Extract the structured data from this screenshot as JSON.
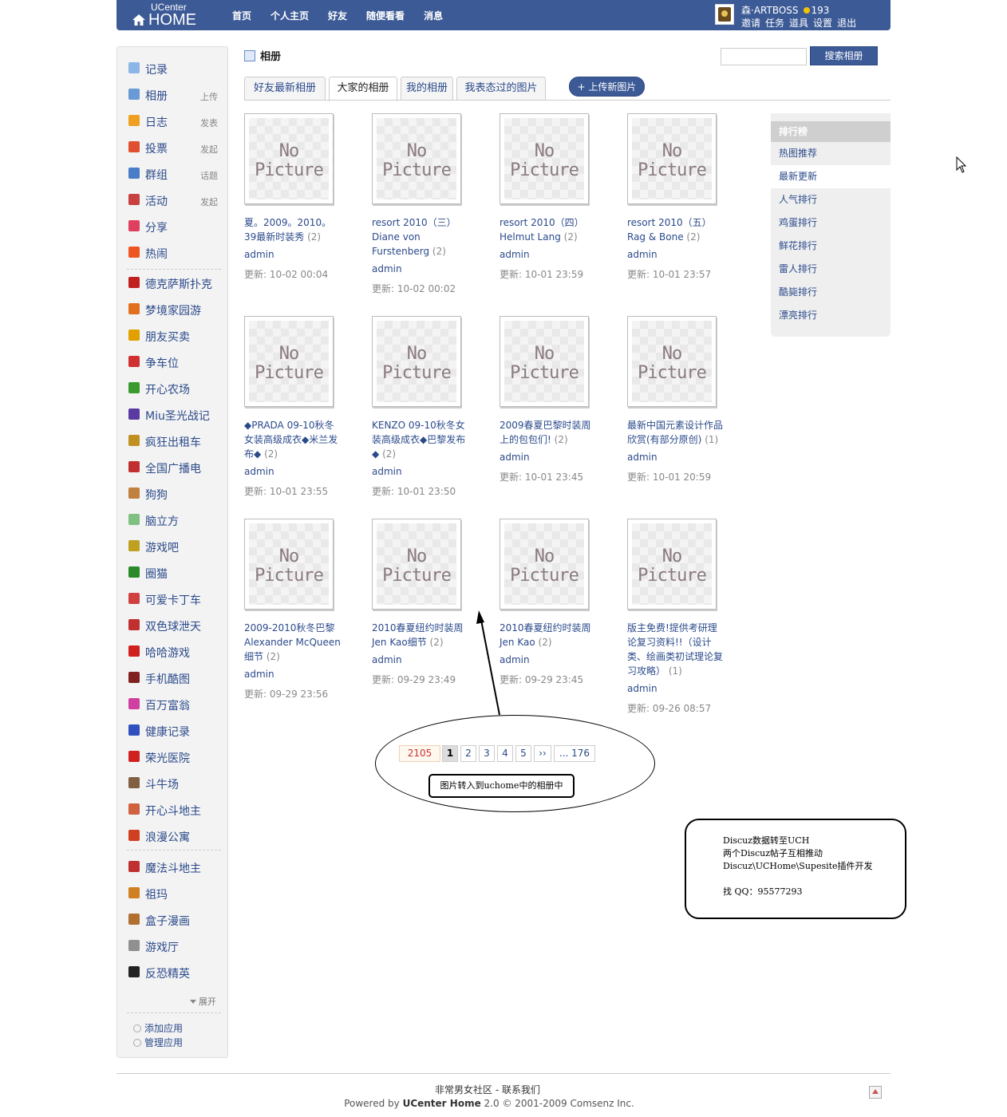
{
  "header": {
    "logo_small": "UCenter",
    "logo_big": "HOME",
    "nav": [
      "首页",
      "个人主页",
      "好友",
      "随便看看",
      "消息"
    ],
    "user_name": "森·ARTBOSS",
    "credits": "193",
    "user_links": [
      "邀请",
      "任务",
      "道具",
      "设置",
      "退出"
    ]
  },
  "sidebar": {
    "core": [
      {
        "label": "记录",
        "action": "",
        "icon": "bubble-icon",
        "color": "#8bb6e6"
      },
      {
        "label": "相册",
        "action": "上传",
        "icon": "photo-icon",
        "color": "#6a9ad6"
      },
      {
        "label": "日志",
        "action": "发表",
        "icon": "notebook-icon",
        "color": "#f0a020"
      },
      {
        "label": "投票",
        "action": "发起",
        "icon": "bar-chart-icon",
        "color": "#e05030"
      },
      {
        "label": "群组",
        "action": "话题",
        "icon": "group-icon",
        "color": "#4a7cc8"
      },
      {
        "label": "活动",
        "action": "发起",
        "icon": "calendar-icon",
        "color": "#c84040"
      },
      {
        "label": "分享",
        "action": "",
        "icon": "heart-icon",
        "color": "#e04060"
      },
      {
        "label": "热闹",
        "action": "",
        "icon": "flame-icon",
        "color": "#ee5522"
      }
    ],
    "apps1": [
      {
        "label": "德克萨斯扑克",
        "icon": "poker-icon",
        "color": "#c02020"
      },
      {
        "label": "梦境家园游",
        "icon": "home-game-icon",
        "color": "#e07020"
      },
      {
        "label": "朋友买卖",
        "icon": "coin-icon",
        "color": "#e0a000"
      },
      {
        "label": "争车位",
        "icon": "parking-icon",
        "color": "#d03030"
      },
      {
        "label": "开心农场",
        "icon": "sprout-icon",
        "color": "#3a9a30"
      },
      {
        "label": "Miu圣光战记",
        "icon": "sword-icon",
        "color": "#5a3aa0"
      },
      {
        "label": "疯狂出租车",
        "icon": "taxi-icon",
        "color": "#c09020"
      },
      {
        "label": "全国广播电",
        "icon": "radio-icon",
        "color": "#c03030"
      },
      {
        "label": "狗狗",
        "icon": "dog-icon",
        "color": "#c08040"
      },
      {
        "label": "脑立方",
        "icon": "cloud-icon",
        "color": "#80c080"
      },
      {
        "label": "游戏吧",
        "icon": "trophy-icon",
        "color": "#c0a020"
      },
      {
        "label": "圈猫",
        "icon": "cat-icon",
        "color": "#2a8a2a"
      },
      {
        "label": "可爱卡丁车",
        "icon": "kart-icon",
        "color": "#d04040"
      },
      {
        "label": "双色球泄天",
        "icon": "lottery-icon",
        "color": "#c03030"
      },
      {
        "label": "哈哈游戏",
        "icon": "haha-icon",
        "color": "#d02020"
      },
      {
        "label": "手机酷图",
        "icon": "phone-icon",
        "color": "#802020"
      },
      {
        "label": "百万富翁",
        "icon": "star-icon",
        "color": "#d040a0"
      },
      {
        "label": "健康记录",
        "icon": "health-icon",
        "color": "#3050c0"
      },
      {
        "label": "荣光医院",
        "icon": "hospital-icon",
        "color": "#d02020"
      },
      {
        "label": "斗牛场",
        "icon": "bull-icon",
        "color": "#806040"
      },
      {
        "label": "开心斗地主",
        "icon": "cards-icon",
        "color": "#d06040"
      },
      {
        "label": "浪漫公寓",
        "icon": "house-icon",
        "color": "#d04020"
      }
    ],
    "apps2": [
      {
        "label": "魔法斗地主",
        "icon": "magic-icon",
        "color": "#c03030"
      },
      {
        "label": "祖玛",
        "icon": "zuma-icon",
        "color": "#d08020"
      },
      {
        "label": "盒子漫画",
        "icon": "box-icon",
        "color": "#b07030"
      },
      {
        "label": "游戏厅",
        "icon": "gamepad-icon",
        "color": "#909090"
      },
      {
        "label": "反恐精英",
        "icon": "cs-icon",
        "color": "#222222"
      }
    ],
    "more": "展开",
    "add_app": "添加应用",
    "manage_app": "管理应用"
  },
  "main": {
    "title": "相册",
    "search_button": "搜索相册",
    "tabs": [
      "好友最新相册",
      "大家的相册",
      "我的相册",
      "我表态过的图片"
    ],
    "active_tab": 1,
    "upload_button": "上传新图片",
    "no_picture_line1": "No",
    "no_picture_line2": "Picture",
    "albums": [
      {
        "name": "夏。2009。2010。39最新时装秀",
        "count": "(2)",
        "owner": "admin",
        "updated": "更新: 10-02 00:04"
      },
      {
        "name": "resort 2010（三）Diane von Furstenberg",
        "count": "(2)",
        "owner": "admin",
        "updated": "更新: 10-02 00:02"
      },
      {
        "name": "resort 2010（四）Helmut Lang",
        "count": "(2)",
        "owner": "admin",
        "updated": "更新: 10-01 23:59"
      },
      {
        "name": "resort 2010（五）Rag & Bone",
        "count": "(2)",
        "owner": "admin",
        "updated": "更新: 10-01 23:57"
      },
      {
        "name": "◆PRADA 09-10秋冬女装高级成衣◆米兰发布◆",
        "count": "(2)",
        "owner": "admin",
        "updated": "更新: 10-01 23:55"
      },
      {
        "name": "KENZO 09-10秋冬女装高级成衣◆巴黎发布◆",
        "count": "(2)",
        "owner": "admin",
        "updated": "更新: 10-01 23:50"
      },
      {
        "name": "2009春夏巴黎时装周上的包包们!",
        "count": "(2)",
        "owner": "admin",
        "updated": "更新: 10-01 23:45"
      },
      {
        "name": "最新中国元素设计作品欣赏(有部分原创)",
        "count": "(1)",
        "owner": "admin",
        "updated": "更新: 10-01 20:59"
      },
      {
        "name": "2009-2010秋冬巴黎Alexander McQueen细节",
        "count": "(2)",
        "owner": "admin",
        "updated": "更新: 09-29 23:56"
      },
      {
        "name": "2010春夏纽约时装周 Jen Kao细节",
        "count": "(2)",
        "owner": "admin",
        "updated": "更新: 09-29 23:49"
      },
      {
        "name": "2010春夏纽约时装周 Jen Kao",
        "count": "(2)",
        "owner": "admin",
        "updated": "更新: 09-29 23:45"
      },
      {
        "name": "版主免费!提供考研理论复习资料!!（设计类、绘画类初试理论复习攻略）",
        "count": "(1)",
        "owner": "admin",
        "updated": "更新: 09-26 08:57"
      }
    ]
  },
  "ranking": {
    "title": "排行榜",
    "items": [
      "热图推荐",
      "最新更新",
      "人气排行",
      "鸡蛋排行",
      "鲜花排行",
      "雷人排行",
      "酷毙排行",
      "漂亮排行"
    ],
    "selected": 1
  },
  "pager": {
    "total": "2105",
    "pages": [
      "1",
      "2",
      "3",
      "4",
      "5",
      "››",
      "... 176"
    ],
    "current": 0
  },
  "annotations": {
    "callout1": "图片转入到uchome中的相册中",
    "callout2_lines": [
      "Discuz数据转至UCH",
      "两个Discuz帖子互相推动",
      "Discuz\\UCHome\\Supesite插件开发",
      "",
      "找 QQ：95577293"
    ]
  },
  "footer": {
    "site_name": "非常男女社区",
    "contact": "联系我们",
    "powered_prefix": "Powered by",
    "powered_product": "UCenter Home",
    "powered_suffix": "2.0 © 2001-2009 Comsenz Inc."
  }
}
